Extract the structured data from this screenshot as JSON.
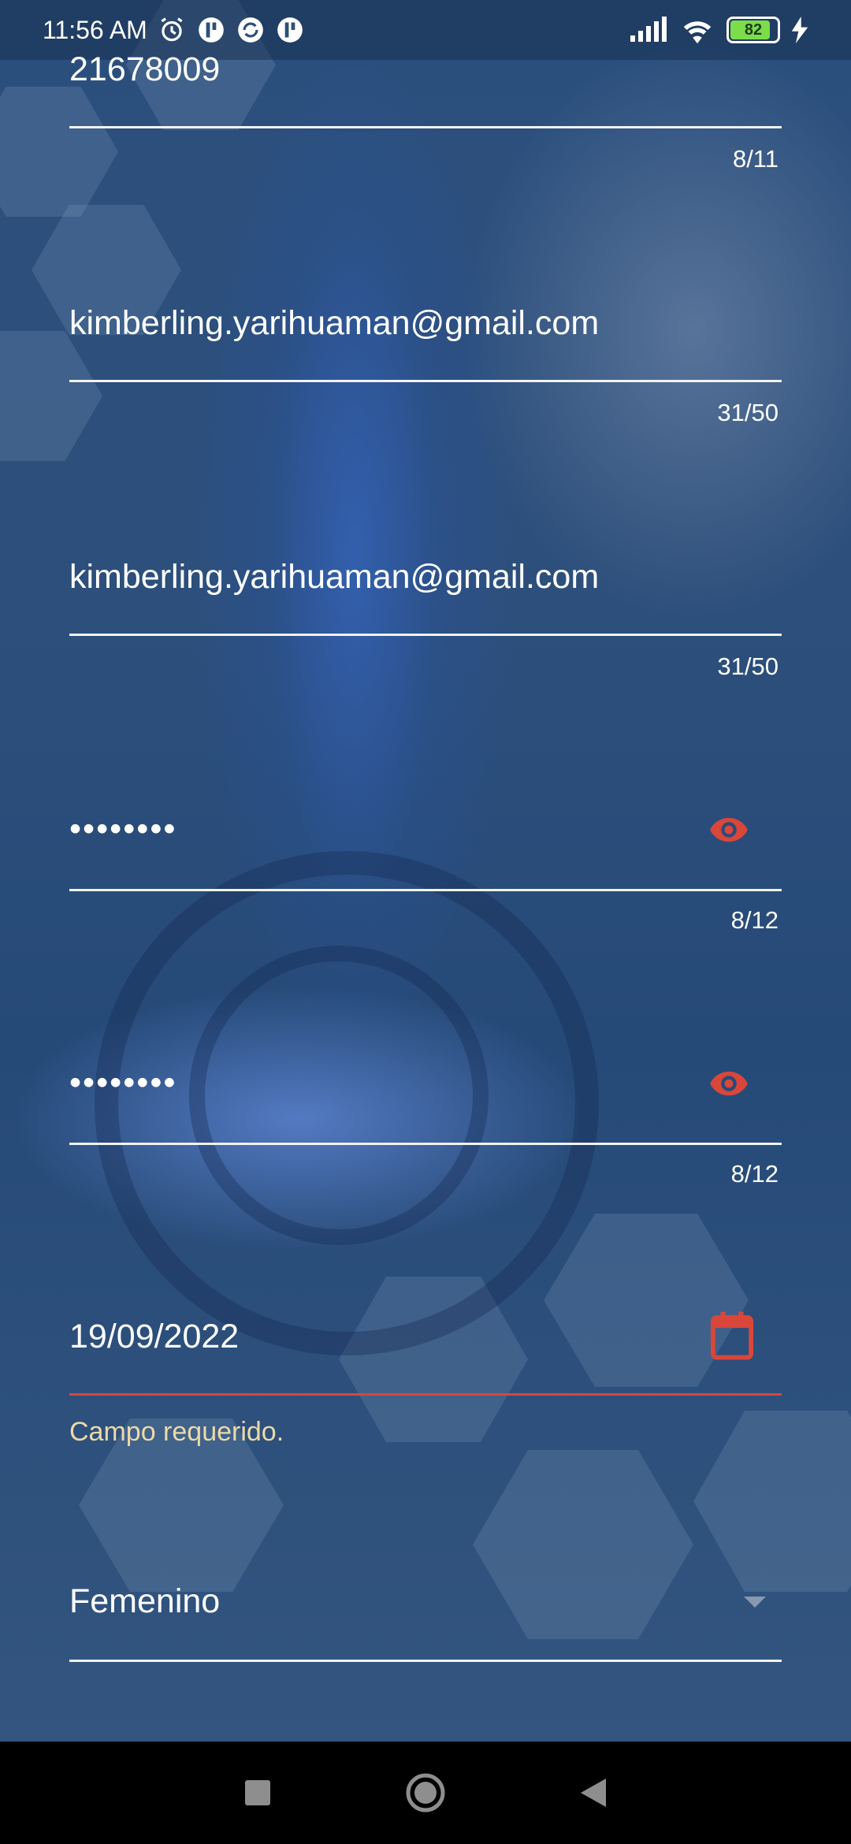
{
  "status_bar": {
    "time": "11:56 AM",
    "battery": "82",
    "icons": [
      "alarm-icon",
      "app-notification-icon",
      "sync-icon",
      "app-notification-icon",
      "signal-icon",
      "wifi-icon",
      "battery-icon",
      "charging-icon"
    ]
  },
  "form": {
    "doc_number": {
      "value": "21678009",
      "counter": "8/11"
    },
    "email": {
      "value": "kimberling.yarihuaman@gmail.com",
      "counter": "31/50"
    },
    "email_confirm": {
      "value": "kimberling.yarihuaman@gmail.com",
      "counter": "31/50"
    },
    "password": {
      "value": "••••••••",
      "counter": "8/12",
      "icon": "eye-icon"
    },
    "password_confirm": {
      "value": "••••••••",
      "counter": "8/12",
      "icon": "eye-icon"
    },
    "birth_date": {
      "value": "19/09/2022",
      "error": "Campo requerido.",
      "icon": "calendar-icon"
    },
    "gender": {
      "value": "Femenino",
      "icon": "dropdown-arrow-icon"
    }
  },
  "colors": {
    "accent": "#d9463a",
    "error_text": "#ecd9a8",
    "underline": "#f2f2f2"
  },
  "nav_bar": {
    "icons": [
      "recents-icon",
      "home-icon",
      "back-icon"
    ]
  }
}
